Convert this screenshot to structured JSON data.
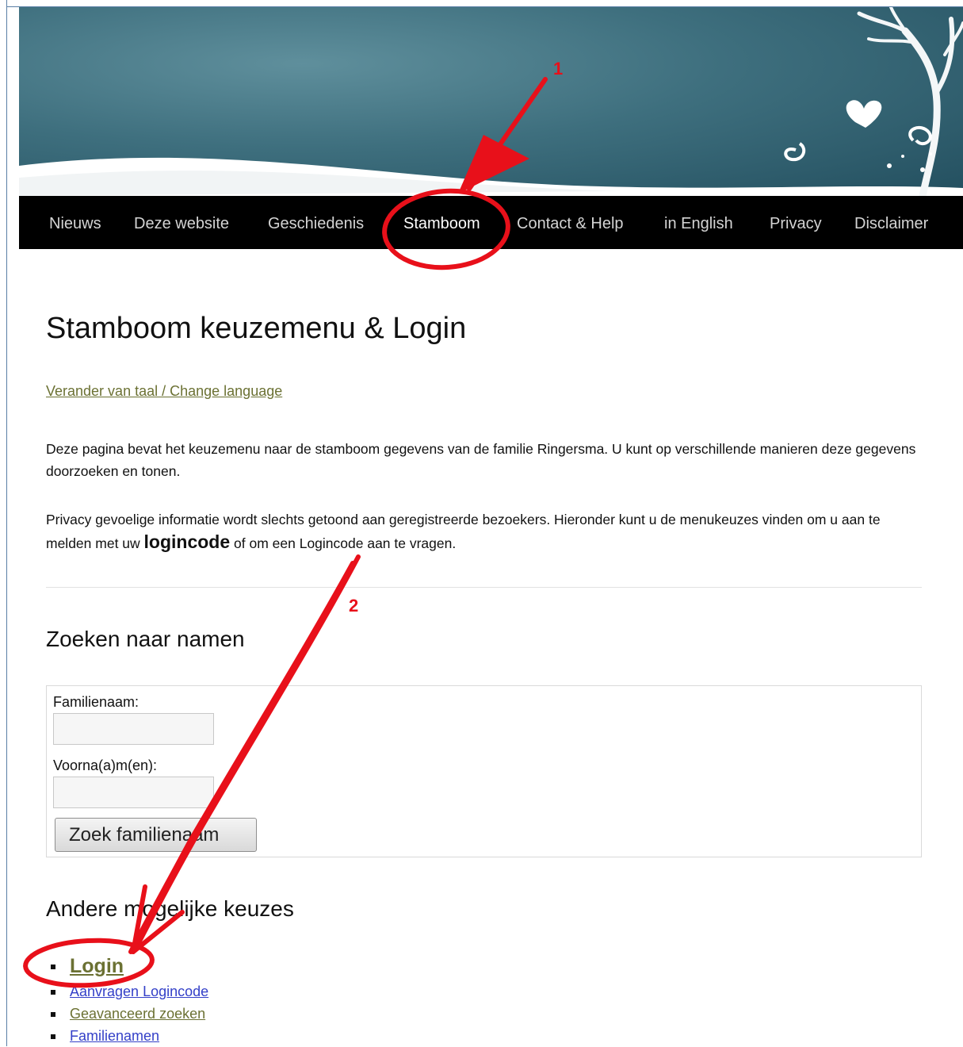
{
  "nav": {
    "items": [
      {
        "label": "Nieuws",
        "active": false
      },
      {
        "label": "Deze website",
        "active": false
      },
      {
        "label": "Geschiedenis",
        "active": false
      },
      {
        "label": "Stamboom",
        "active": true
      },
      {
        "label": "Contact & Help",
        "active": false
      },
      {
        "label": "in English",
        "active": false
      },
      {
        "label": "Privacy",
        "active": false
      },
      {
        "label": "Disclaimer",
        "active": false
      }
    ]
  },
  "page": {
    "title": "Stamboom keuzemenu & Login",
    "language_link": "Verander van taal / Change language",
    "intro": "Deze pagina bevat het keuzemenu naar de stamboom gegevens van de familie Ringersma. U kunt op verschillende manieren deze gegevens doorzoeken en tonen.",
    "privacy_before": "Privacy gevoelige informatie wordt slechts getoond aan geregistreerde bezoekers. Hieronder kunt u de menukeuzes vinden om u aan te melden met uw ",
    "privacy_highlight": "logincode",
    "privacy_after": " of om een Logincode aan te vragen."
  },
  "search": {
    "heading": "Zoeken naar namen",
    "family_label": "Familienaam:",
    "family_value": "",
    "first_label": "Voorna(a)m(en):",
    "first_value": "",
    "button_label": "Zoek familienaam"
  },
  "other": {
    "heading": "Andere mogelijke keuzes",
    "links": [
      {
        "label": "Login",
        "color": "#6b7133"
      },
      {
        "label": "Aanvragen Logincode",
        "color": "#3440c8"
      },
      {
        "label": "Geavanceerd zoeken",
        "color": "#6b7133"
      },
      {
        "label": "Familienamen",
        "color": "#3440c8"
      }
    ]
  },
  "annotations": {
    "marker_1": "1",
    "marker_2": "2",
    "color": "#e8101a"
  },
  "colors": {
    "nav_background": "#000000",
    "visited_link": "#6b7133",
    "link": "#3440c8"
  }
}
